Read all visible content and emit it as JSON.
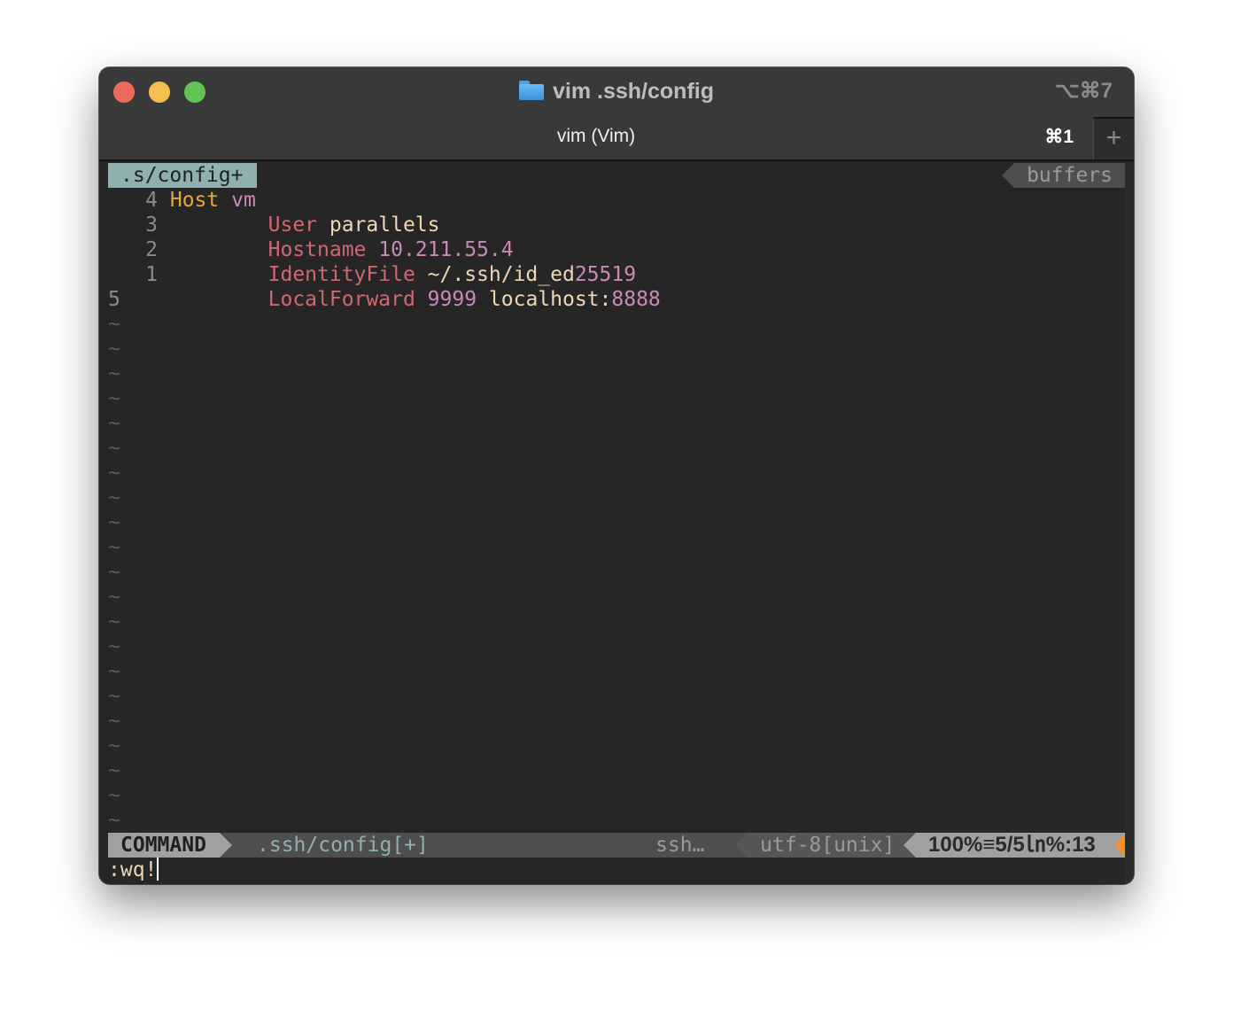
{
  "window": {
    "title": "vim .ssh/config",
    "title_icon": "folder-icon",
    "window_shortcut": "⌥⌘7",
    "traffic_lights": {
      "close": "#ed6a5e",
      "minimize": "#f5bf4f",
      "maximize": "#61c454"
    }
  },
  "tabbar": {
    "tabs": [
      {
        "label": "vim (Vim)",
        "shortcut": "⌘1"
      }
    ],
    "new_tab_label": "+"
  },
  "vim": {
    "tabline": {
      "file": ".s/config+",
      "buffers_label": "buffers"
    },
    "lines": [
      {
        "number": "4",
        "indent": "",
        "tokens": [
          {
            "text": "Host",
            "cls": "kw-host"
          },
          {
            "text": " "
          },
          {
            "text": "vm",
            "cls": "num"
          }
        ]
      },
      {
        "number": "3",
        "indent": "        ",
        "tokens": [
          {
            "text": "User",
            "cls": "kw"
          },
          {
            "text": " "
          },
          {
            "text": "parallels",
            "cls": "val"
          }
        ]
      },
      {
        "number": "2",
        "indent": "        ",
        "tokens": [
          {
            "text": "Hostname",
            "cls": "kw"
          },
          {
            "text": " "
          },
          {
            "text": "10.211.55.4",
            "cls": "num"
          }
        ]
      },
      {
        "number": "1",
        "indent": "        ",
        "tokens": [
          {
            "text": "IdentityFile",
            "cls": "kw"
          },
          {
            "text": " "
          },
          {
            "text": "~/.ssh/id_ed",
            "cls": "val"
          },
          {
            "text": "25519",
            "cls": "num"
          }
        ]
      },
      {
        "number": "5",
        "current": true,
        "indent": "        ",
        "tokens": [
          {
            "text": "LocalForward",
            "cls": "kw"
          },
          {
            "text": " "
          },
          {
            "text": "9999",
            "cls": "num"
          },
          {
            "text": " "
          },
          {
            "text": "localhost:",
            "cls": "val"
          },
          {
            "text": "8888",
            "cls": "num"
          }
        ]
      }
    ],
    "empty_line_marker": "~",
    "empty_line_count": 21,
    "statusline": {
      "mode": "COMMAND",
      "file": ".ssh/config[+]",
      "filetype": "ssh…",
      "encoding": "utf-8[unix]",
      "position": "100%≡5/5㏑%:13"
    },
    "cmdline": ":wq!"
  },
  "colors": {
    "keyword": "#d2676e",
    "host_keyword": "#e6a83a",
    "value": "#f0d6b2",
    "number": "#c98ab8",
    "tabline_active": "#8fb0b0",
    "warning_indicator": "#f0922e"
  }
}
